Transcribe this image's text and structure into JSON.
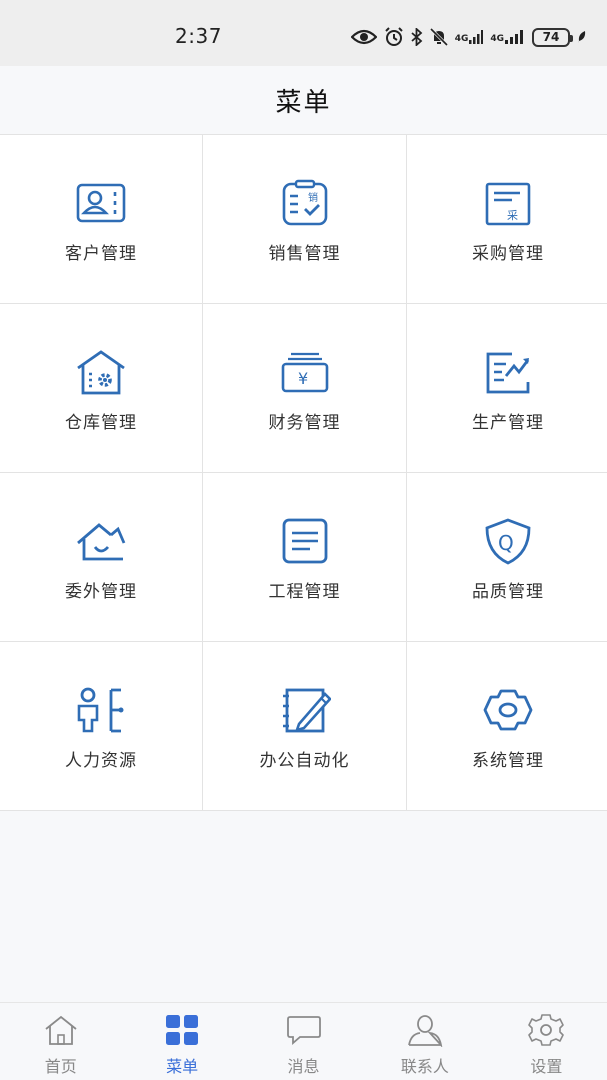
{
  "status_bar": {
    "time": "2:37",
    "net1": "4G",
    "net2": "4G",
    "battery": "74"
  },
  "header": {
    "title": "菜单"
  },
  "menu": {
    "items": [
      {
        "label": "客户管理",
        "icon": "customer-card-icon"
      },
      {
        "label": "销售管理",
        "icon": "sales-clipboard-icon",
        "badge": "销"
      },
      {
        "label": "采购管理",
        "icon": "purchase-doc-icon",
        "badge": "采"
      },
      {
        "label": "仓库管理",
        "icon": "warehouse-icon"
      },
      {
        "label": "财务管理",
        "icon": "finance-icon",
        "badge": "¥"
      },
      {
        "label": "生产管理",
        "icon": "production-chart-icon"
      },
      {
        "label": "委外管理",
        "icon": "outsource-house-icon"
      },
      {
        "label": "工程管理",
        "icon": "engineering-doc-icon"
      },
      {
        "label": "品质管理",
        "icon": "quality-shield-icon",
        "badge": "Q"
      },
      {
        "label": "人力资源",
        "icon": "hr-person-icon"
      },
      {
        "label": "办公自动化",
        "icon": "office-notebook-icon"
      },
      {
        "label": "系统管理",
        "icon": "system-gear-icon"
      }
    ]
  },
  "tabbar": {
    "tabs": [
      {
        "label": "首页",
        "icon": "home-icon"
      },
      {
        "label": "菜单",
        "icon": "menu-grid-icon",
        "active": true
      },
      {
        "label": "消息",
        "icon": "message-icon"
      },
      {
        "label": "联系人",
        "icon": "contacts-icon"
      },
      {
        "label": "设置",
        "icon": "settings-icon"
      }
    ]
  },
  "colors": {
    "accent": "#3a6fd8",
    "icon_blue": "#2f6db5",
    "inactive": "#8a8a8a"
  }
}
